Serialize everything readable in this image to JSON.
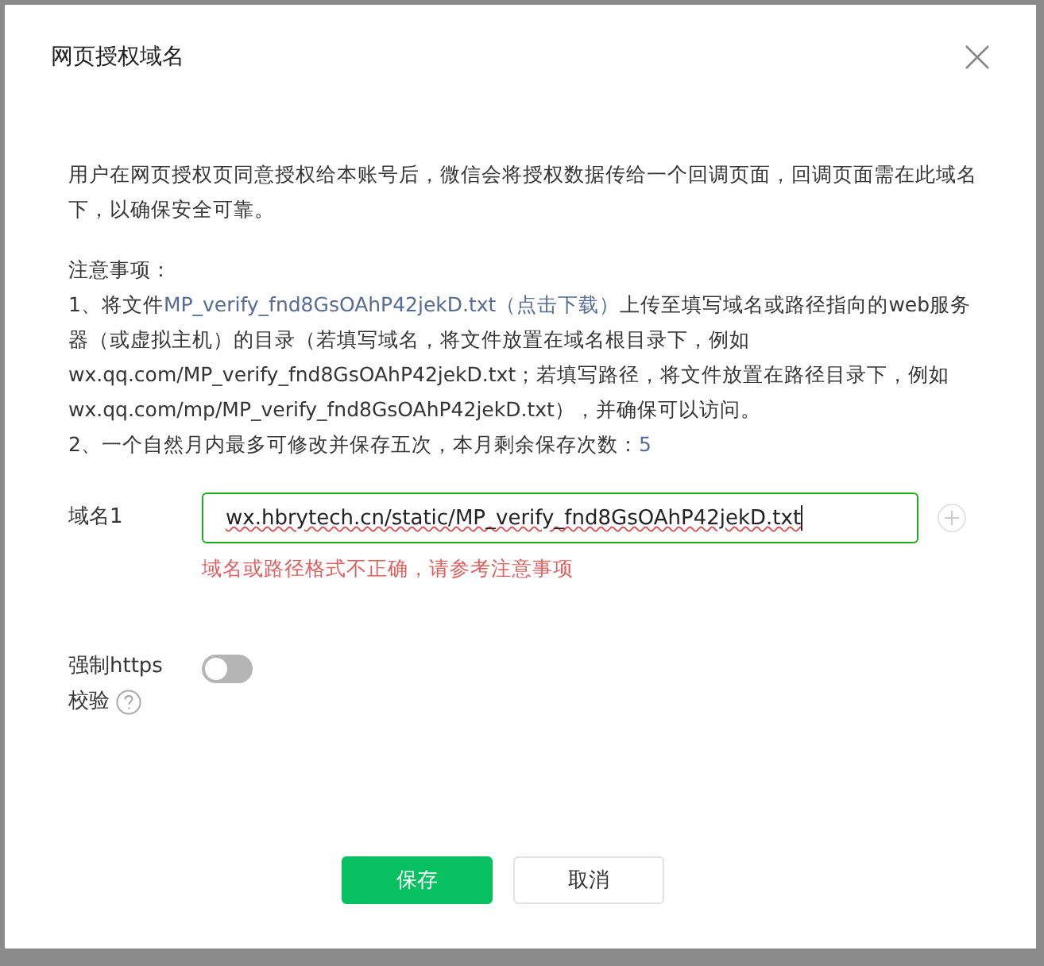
{
  "dialog": {
    "title": "网页授权域名",
    "description": "用户在网页授权页同意授权给本账号后，微信会将授权数据传给一个回调页面，回调页面需在此域名下，以确保安全可靠。",
    "notes_heading": "注意事项：",
    "note_1": {
      "before": "1、将文件",
      "link": "MP_verify_fnd8GsOAhP42jekD.txt（点击下载）",
      "after": "上传至填写域名或路径指向的web服务器（或虚拟主机）的目录（若填写域名，将文件放置在域名根目录下，例如wx.qq.com/MP_verify_fnd8GsOAhP42jekD.txt；若填写路径，将文件放置在路径目录下，例如wx.qq.com/mp/MP_verify_fnd8GsOAhP42jekD.txt），并确保可以访问。"
    },
    "note_2": {
      "text": "2、一个自然月内最多可修改并保存五次，本月剩余保存次数：",
      "count": "5"
    },
    "fields": [
      {
        "label": "域名1",
        "value": "wx.hbrytech.cn/static/MP_verify_fnd8GsOAhP42jekD.txt",
        "error": "域名或路径格式不正确，请参考注意事项"
      }
    ],
    "https_check": {
      "label_lines": [
        "强制https",
        "校验"
      ],
      "on": false
    },
    "buttons": [
      {
        "label": "保存",
        "kind": "primary"
      },
      {
        "label": "取消",
        "kind": "default"
      }
    ]
  }
}
